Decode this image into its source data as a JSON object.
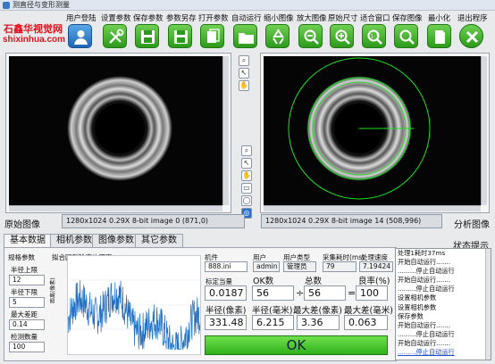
{
  "window": {
    "title": "测直径与变形测量"
  },
  "brand": {
    "line1": "石鑫华视觉网",
    "line2": "shixinhua.com"
  },
  "toolbar": [
    {
      "label": "用户登陆",
      "icon": "user-icon"
    },
    {
      "label": "设置参数",
      "icon": "tools-icon"
    },
    {
      "label": "保存参数",
      "icon": "save-icon"
    },
    {
      "label": "参数另存",
      "icon": "save-as-icon"
    },
    {
      "label": "打开参数",
      "icon": "copy-document-icon"
    },
    {
      "label": "自动运行",
      "icon": "folder-open-icon"
    },
    {
      "label": "缩小图像",
      "icon": "recycle-icon"
    },
    {
      "label": "放大图像",
      "icon": "zoom-out-icon"
    },
    {
      "label": "原始尺寸",
      "icon": "zoom-in-icon"
    },
    {
      "label": "适合窗口",
      "icon": "zoom-1to1-icon"
    },
    {
      "label": "保存图像",
      "icon": "zoom-fit-icon"
    },
    {
      "label": "最小化",
      "icon": "document-icon"
    },
    {
      "label": "退出程序",
      "icon": "minimize-icon"
    },
    {
      "label": "",
      "icon": "close-icon"
    }
  ],
  "left_view": {
    "label": "原始图像",
    "info": "1280x1024 0.29X 8-bit image 0    (871,0)"
  },
  "right_view": {
    "label": "分析图像",
    "info": "1280x1024 0.29X 8-bit image 14    (508,996)"
  },
  "tabs": [
    "基本数据",
    "相机参数",
    "图像参数",
    "其它参数"
  ],
  "params": {
    "title": "规格参数",
    "radius_upper_label": "半径上限",
    "radius_upper": "12",
    "radius_lower_label": "半径下限",
    "radius_lower": "5",
    "max_deform_label": "最大差距",
    "max_deform": "0.14",
    "contour_count_label": "检测数量",
    "contour_count": "100"
  },
  "chart_title": "拟合圆到轮廓的距离",
  "chart_data": {
    "type": "line",
    "title": "拟合圆到轮廓的距离",
    "ylabel": "距离(像素)",
    "ylim": [
      0,
      4
    ],
    "n_points": 360,
    "note_series": "blue noisy line, values mostly 0.5-3.4"
  },
  "camera": {
    "label": "机件",
    "value": "888.ini"
  },
  "user": {
    "label": "用户",
    "value": "admin"
  },
  "user_type": {
    "label": "用户类型",
    "value": "管理员"
  },
  "acq_time": {
    "label": "采集耗时(ms)",
    "value": "79"
  },
  "proc_speed": {
    "label": "处理速度",
    "value": "7.19424"
  },
  "metrics": {
    "calib_label": "标定当量",
    "calib": "0.0187",
    "ok_label": "OK数",
    "ok": "56",
    "total_label": "总数",
    "total": "56",
    "rate_label": "良率(%)",
    "rate": "100",
    "div": "÷",
    "eq": "=",
    "rpx_label": "半径(像素)",
    "rpx": "331.48",
    "rmm_label": "半径(毫米)",
    "rmm": "6.215",
    "dpx_label": "最大差(像素)",
    "dpx": "3.36",
    "dmm_label": "最大差(毫米)",
    "dmm": "0.063",
    "result": "OK"
  },
  "status": {
    "label": "状态提示",
    "lines": [
      "处理1耗时37ms",
      "开始自动运行.......",
      ".........停止自动运行",
      "开始自动运行.......",
      ".........停止自动运行",
      "设置相机参数",
      "设置相机参数",
      "保存参数",
      "开始自动运行.......",
      ".........停止自动运行",
      "开始自动运行.......",
      ".........停止自动运行"
    ]
  },
  "colors": {
    "accent_green": "#2fb11c",
    "ring_green": "#19e21f",
    "brand_red": "#e0141f",
    "series_blue": "#1f6fc4"
  }
}
